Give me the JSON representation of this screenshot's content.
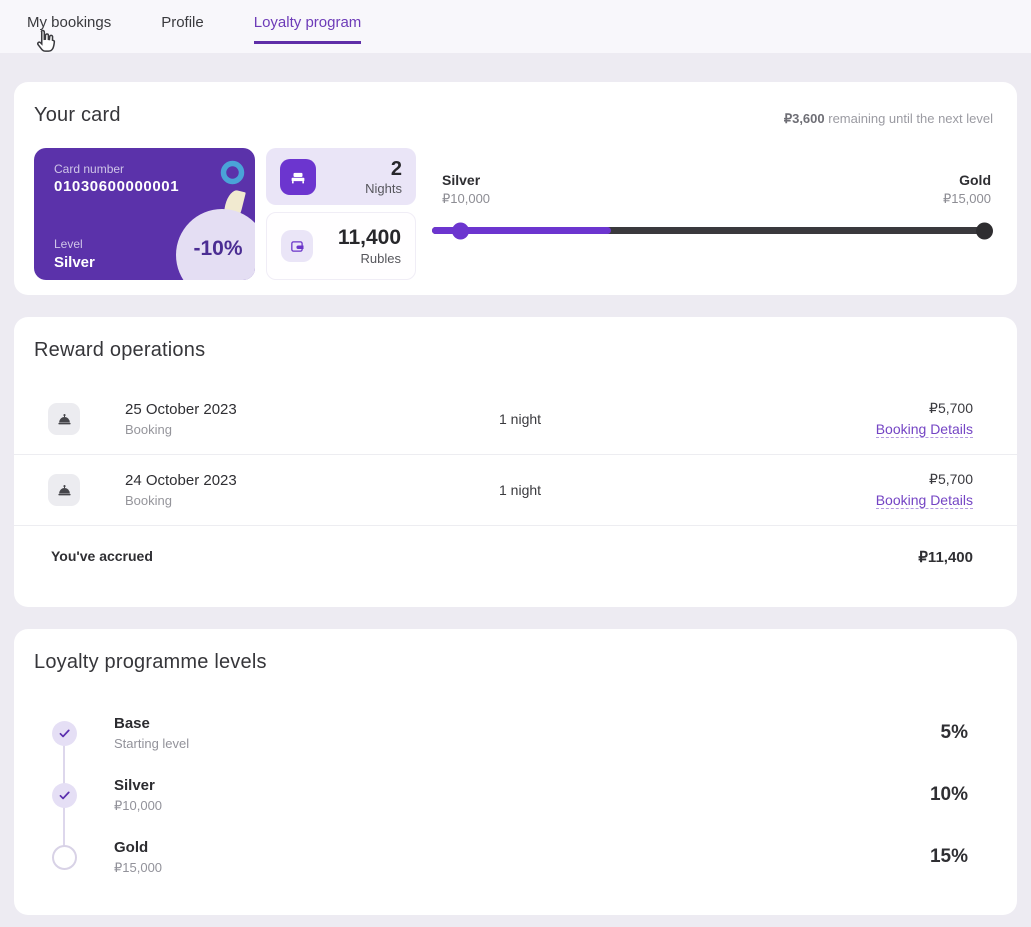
{
  "colors": {
    "accent": "#6c35cf",
    "card_bg": "#5b32aa",
    "active_tab": "#6d3bb8",
    "tab_underline": "#5f2ea8",
    "link": "#7444c4",
    "page_bg": "#edebf2",
    "topnav_bg": "#f8f7fb",
    "panel_bg": "#ffffff",
    "track_dark": "#3a393d",
    "ring_blue": "#4aa3d8",
    "leaf_cream": "#f1ead0",
    "leaf_coral": "#e77f63",
    "discount_circle": "#e4def3",
    "tile_lavender": "#eae5f7"
  },
  "tabs": [
    {
      "label": "My bookings",
      "active": false
    },
    {
      "label": "Profile",
      "active": false
    },
    {
      "label": "Loyalty program",
      "active": true
    }
  ],
  "your_card": {
    "title": "Your card",
    "remaining_amount": "₽3,600",
    "remaining_text": " remaining until the next level",
    "card": {
      "number_label": "Card number",
      "number": "01030600000001",
      "level_label": "Level",
      "level": "Silver",
      "discount": "-10%"
    },
    "stats": [
      {
        "icon": "bed-icon",
        "value": "2",
        "unit": "Nights"
      },
      {
        "icon": "wallet-icon",
        "value": "11,400",
        "unit": "Rubles"
      }
    ],
    "progress": {
      "from_level": "Silver",
      "from_value": "₽10,000",
      "to_level": "Gold",
      "to_value": "₽15,000",
      "fill_percent": 32,
      "marker_percent": 5
    }
  },
  "reward_operations": {
    "title": "Reward operations",
    "rows": [
      {
        "date": "25 October 2023",
        "type": "Booking",
        "nights": "1 night",
        "amount": "₽5,700",
        "link": "Booking Details"
      },
      {
        "date": "24 October 2023",
        "type": "Booking",
        "nights": "1 night",
        "amount": "₽5,700",
        "link": "Booking Details"
      }
    ],
    "total_label": "You've accrued",
    "total_amount": "₽11,400"
  },
  "levels": {
    "title": "Loyalty programme levels",
    "items": [
      {
        "name": "Base",
        "sub": "Starting level",
        "percent": "5%",
        "achieved": true
      },
      {
        "name": "Silver",
        "sub": "₽10,000",
        "percent": "10%",
        "achieved": true
      },
      {
        "name": "Gold",
        "sub": "₽15,000",
        "percent": "15%",
        "achieved": false
      }
    ]
  }
}
